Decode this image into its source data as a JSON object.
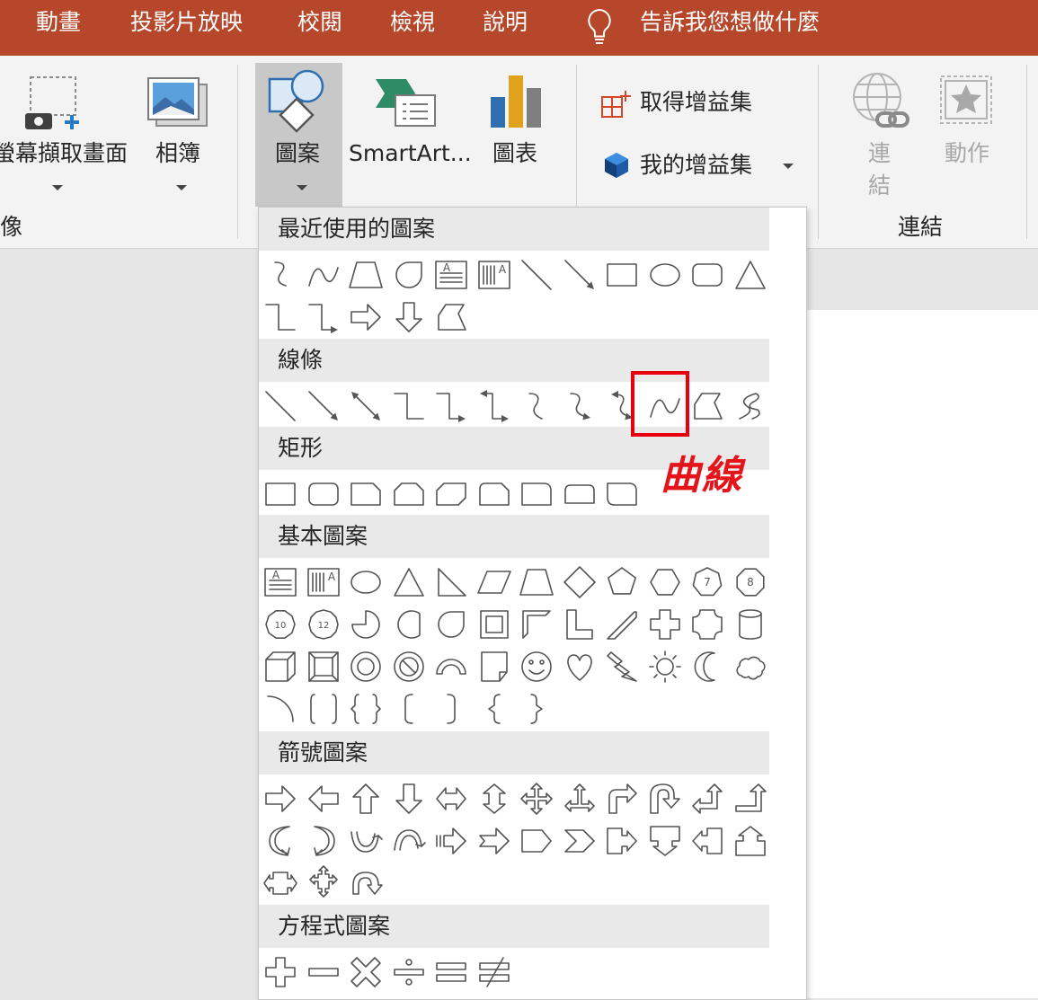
{
  "menubar": {
    "items": [
      "動畫",
      "投影片放映",
      "校閱",
      "檢視",
      "說明"
    ],
    "tell_me": "告訴我您想做什麼",
    "tell_me_icon": "lightbulb-icon",
    "background": "#b7472a"
  },
  "ribbon": {
    "screenshot_label": "螢幕擷取畫面",
    "album_label": "相簿",
    "group_images_label": "像",
    "shapes_label": "圖案",
    "smartart_label": "SmartArt...",
    "chart_label": "圖表",
    "get_addins_label": "取得增益集",
    "my_addins_label": "我的增益集",
    "link_label": "連結",
    "action_label": "動作",
    "group_links_label": "連結"
  },
  "dropdown": {
    "sections": [
      {
        "title": "最近使用的圖案",
        "shapes": [
          "curve-s",
          "arc-curve",
          "trapezoid",
          "teardrop",
          "textbox-horizontal",
          "textbox-vertical",
          "line",
          "arrow-line",
          "rectangle",
          "oval",
          "rounded-rectangle",
          "triangle",
          "elbow-connector",
          "elbow-arrow-connector",
          "right-arrow",
          "down-arrow",
          "freeform"
        ]
      },
      {
        "title": "線條",
        "shapes": [
          "line",
          "arrow-line",
          "double-arrow-line",
          "elbow-connector",
          "elbow-arrow-connector",
          "elbow-double-arrow",
          "curved-connector",
          "curved-arrow-connector",
          "curved-double-arrow",
          "curve",
          "freeform",
          "scribble"
        ]
      },
      {
        "title": "矩形",
        "shapes": [
          "rectangle",
          "rounded-rectangle",
          "snip-single-corner",
          "snip-same-side",
          "snip-diagonal",
          "snip-round-corner",
          "round-single-corner",
          "round-same-side",
          "round-diagonal"
        ]
      },
      {
        "title": "基本圖案",
        "shapes": [
          "textbox-horizontal",
          "textbox-vertical",
          "oval",
          "triangle",
          "right-triangle",
          "parallelogram",
          "trapezoid",
          "diamond",
          "pentagon",
          "hexagon",
          "heptagon",
          "octagon",
          "decagon",
          "dodecagon",
          "pie",
          "chord",
          "teardrop",
          "frame",
          "half-frame",
          "l-shape",
          "diagonal-stripe",
          "cross",
          "plaque",
          "can",
          "cube",
          "bevel",
          "donut",
          "no-symbol",
          "block-arc",
          "folded-corner",
          "smiley-face",
          "heart",
          "lightning-bolt",
          "sun",
          "moon",
          "cloud",
          "arc",
          "double-bracket",
          "double-brace",
          "left-bracket",
          "right-bracket",
          "left-brace",
          "right-brace"
        ]
      },
      {
        "title": "箭號圖案",
        "shapes": [
          "right-arrow",
          "left-arrow",
          "up-arrow",
          "down-arrow",
          "left-right-arrow",
          "up-down-arrow",
          "quad-arrow",
          "left-right-up-arrow",
          "bent-arrow",
          "u-turn-arrow",
          "left-up-arrow",
          "bent-up-arrow",
          "curved-right-arrow",
          "curved-left-arrow",
          "curved-up-arrow",
          "curved-down-arrow",
          "striped-right-arrow",
          "notched-right-arrow",
          "pentagon-arrow",
          "chevron",
          "right-arrow-callout",
          "down-arrow-callout",
          "left-arrow-callout",
          "up-arrow-callout",
          "left-right-arrow-callout",
          "quad-arrow-callout",
          "circular-arrow"
        ]
      },
      {
        "title": "方程式圖案",
        "shapes": [
          "plus",
          "minus",
          "multiply",
          "divide",
          "equal",
          "not-equal"
        ]
      }
    ],
    "shape_labels": {
      "decagon": "10",
      "dodecagon": "12",
      "heptagon": "7",
      "octagon": "8"
    }
  },
  "annotation": {
    "text": "曲線",
    "highlighted_shape": "curve",
    "color": "#e8000e"
  }
}
